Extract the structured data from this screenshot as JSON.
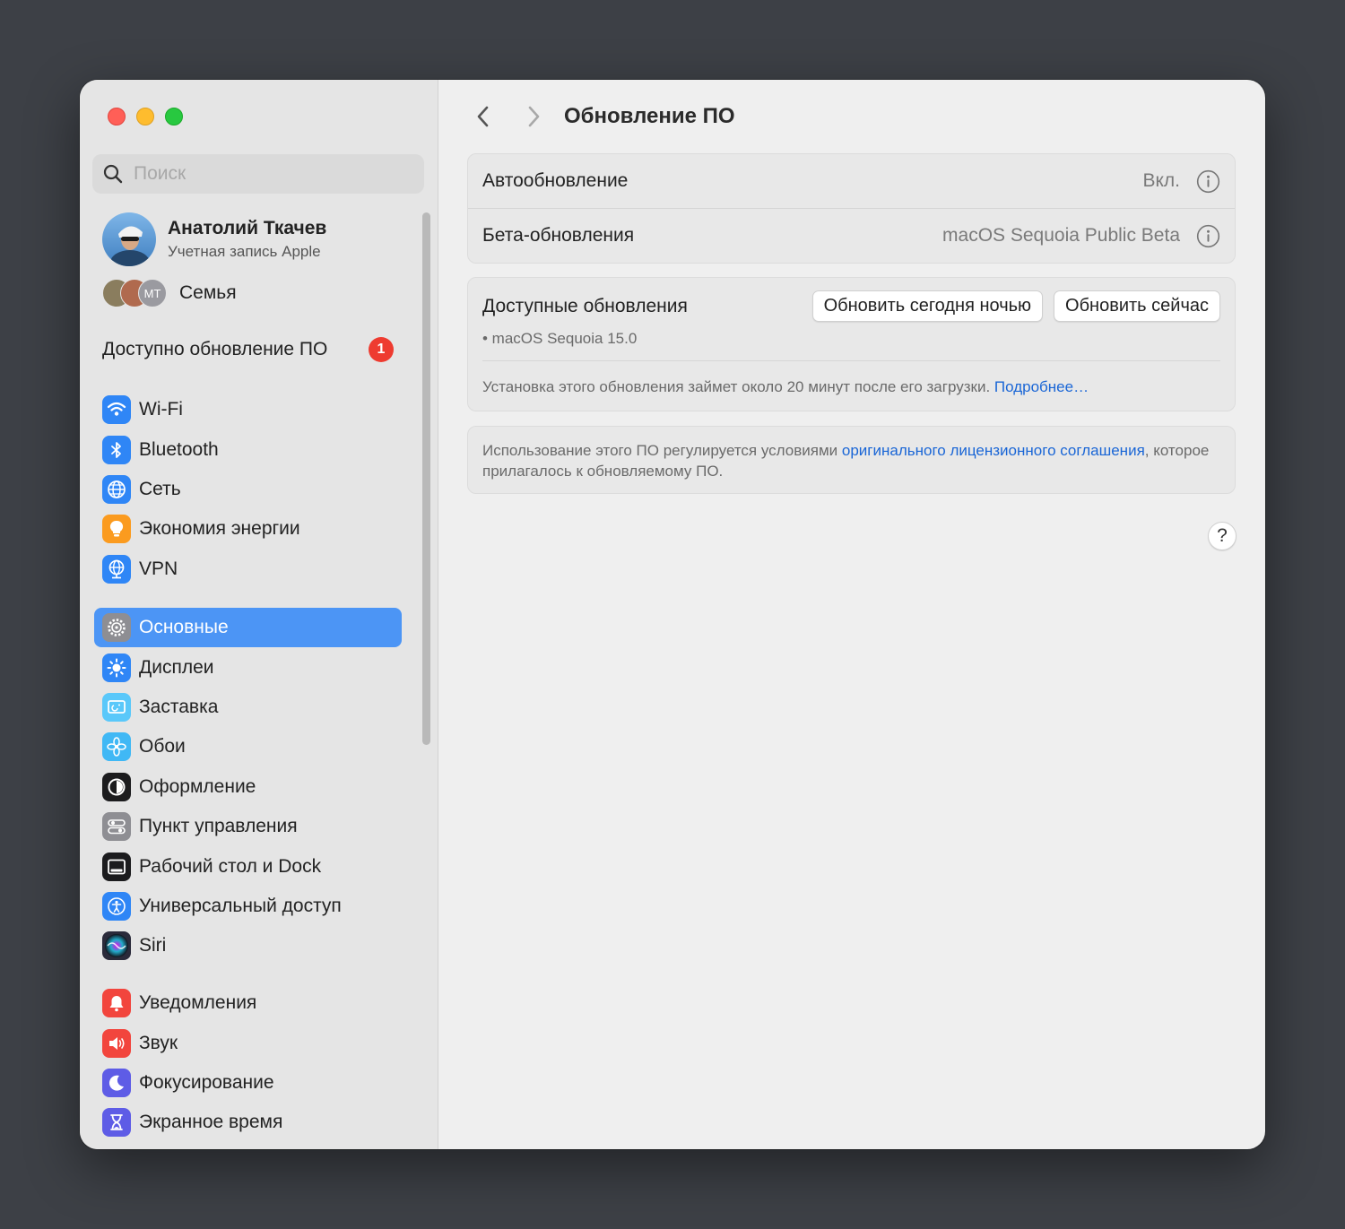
{
  "sidebar": {
    "search_placeholder": "Поиск",
    "account": {
      "name": "Анатолий Ткачев",
      "subtitle": "Учетная запись Apple"
    },
    "family": {
      "initials": "МТ",
      "label": "Семья"
    },
    "update_item": {
      "label": "Доступно обновление ПО",
      "badge": "1"
    },
    "group1": [
      {
        "label": "Wi-Fi",
        "icon": "wifi-icon",
        "color": "#2f86f6"
      },
      {
        "label": "Bluetooth",
        "icon": "bluetooth-icon",
        "color": "#2f86f6"
      },
      {
        "label": "Сеть",
        "icon": "globe-icon",
        "color": "#2f86f6"
      },
      {
        "label": "Экономия энергии",
        "icon": "lightbulb-icon",
        "color": "#fb9b1f"
      },
      {
        "label": "VPN",
        "icon": "vpn-globe-icon",
        "color": "#2f86f6"
      }
    ],
    "group2": [
      {
        "label": "Основные",
        "icon": "gear-icon",
        "color": "#8e8e93",
        "selected": true
      },
      {
        "label": "Дисплеи",
        "icon": "sun-icon",
        "color": "#2f86f6"
      },
      {
        "label": "Заставка",
        "icon": "screensaver-icon",
        "color": "#5ac8fa"
      },
      {
        "label": "Обои",
        "icon": "flower-icon",
        "color": "#40b8f5"
      },
      {
        "label": "Оформление",
        "icon": "appearance-icon",
        "color": "#1c1c1e"
      },
      {
        "label": "Пункт управления",
        "icon": "control-center-icon",
        "color": "#8e8e93"
      },
      {
        "label": "Рабочий стол и Dock",
        "icon": "dock-icon",
        "color": "#1c1c1e"
      },
      {
        "label": "Универсальный доступ",
        "icon": "accessibility-icon",
        "color": "#2f86f6"
      },
      {
        "label": "Siri",
        "icon": "siri-icon",
        "color": "#2a2a3a"
      }
    ],
    "group3": [
      {
        "label": "Уведомления",
        "icon": "bell-icon",
        "color": "#f2453d"
      },
      {
        "label": "Звук",
        "icon": "speaker-icon",
        "color": "#f2453d"
      },
      {
        "label": "Фокусирование",
        "icon": "moon-icon",
        "color": "#5e5ce6"
      },
      {
        "label": "Экранное время",
        "icon": "hourglass-icon",
        "color": "#5e5ce6"
      }
    ]
  },
  "main": {
    "title": "Обновление ПО",
    "settings": [
      {
        "key": "Автообновление",
        "value": "Вкл."
      },
      {
        "key": "Бета-обновления",
        "value": "macOS Sequoia Public Beta"
      }
    ],
    "updates": {
      "title": "Доступные обновления",
      "item": "• macOS Sequoia 15.0",
      "btn_tonight": "Обновить сегодня ночью",
      "btn_now": "Обновить сейчас",
      "note": "Установка этого обновления займет около 20 минут после его загрузки.",
      "more_link": "Подробнее…"
    },
    "license": {
      "text_before": "Использование этого ПО регулируется условиями",
      "link": "оригинального лицензионного соглашения",
      "text_after": ", которое прилагалось к обновляемому ПО."
    },
    "help": "?"
  },
  "colors": {
    "accent": "#4c95f5",
    "link": "#1a66d6",
    "badge": "#ee3b30"
  }
}
